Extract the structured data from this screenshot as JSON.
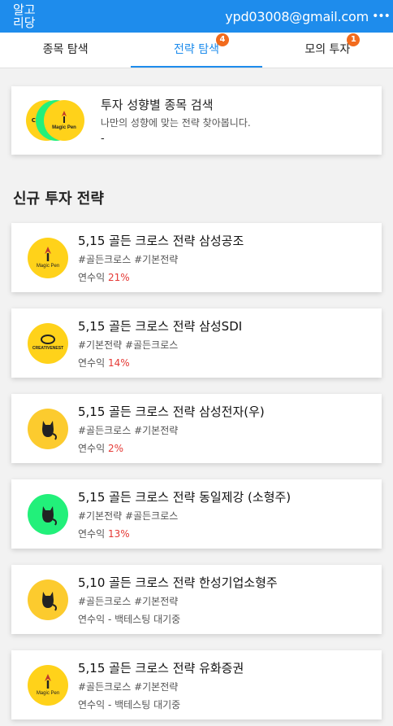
{
  "header": {
    "brand": "알고리당",
    "email": "ypd03008@gmail.com",
    "more_icon": "more-dots-icon",
    "bg_color": "#1e8cec"
  },
  "tabs": [
    {
      "label": "종목 탐색",
      "badge": null,
      "active": false
    },
    {
      "label": "전략 탐색",
      "badge": "4",
      "active": true
    },
    {
      "label": "모의 투자",
      "badge": "1",
      "active": false
    }
  ],
  "search_card": {
    "title": "투자 성향별 종목 검색",
    "subtitle": "나만의 성향에 맞는 전략 찾아봅니다.",
    "dash": "-",
    "logo_texts": [
      "CR",
      "Magic Pen"
    ]
  },
  "section_title": "신규 투자 전략",
  "return_label": "연수익",
  "strategies": [
    {
      "title": "5,15 골든 크로스 전략 삼성공조",
      "tags": "#골든크로스 #기본전략",
      "return": "21%",
      "pending": false,
      "logo_color": "#ffd21a",
      "logo_text": "Magic Pen",
      "icon": "magic-pen-logo-icon"
    },
    {
      "title": "5,15 골든 크로스 전략 삼성SDI",
      "tags": "#기본전략 #골든크로스",
      "return": "14%",
      "pending": false,
      "logo_color": "#ffd21a",
      "logo_text": "CREATIVENEST",
      "icon": "creativenest-logo-icon"
    },
    {
      "title": "5,15 골든 크로스 전략 삼성전자(우)",
      "tags": "#골든크로스 #기본전략",
      "return": "2%",
      "pending": false,
      "logo_color": "#fccb2e",
      "logo_text": "",
      "icon": "cat-logo-icon"
    },
    {
      "title": "5,15 골든 크로스 전략 동일제강 (소형주)",
      "tags": "#기본전략 #골든크로스",
      "return": "13%",
      "pending": false,
      "logo_color": "#22f07a",
      "logo_text": "",
      "icon": "cat-logo-icon"
    },
    {
      "title": "5,10 골든 크로스 전략 한성기업소형주",
      "tags": "#골든크로스 #기본전략",
      "return": "- 백테스팅 대기중",
      "pending": true,
      "logo_color": "#fccb2e",
      "logo_text": "",
      "icon": "cat-logo-icon"
    },
    {
      "title": "5,15 골든 크로스 전략 유화증권",
      "tags": "#골든크로스 #기본전략",
      "return": "- 백테스팅 대기중",
      "pending": true,
      "logo_color": "#ffd21a",
      "logo_text": "Magic Pen",
      "icon": "magic-pen-logo-icon"
    }
  ]
}
